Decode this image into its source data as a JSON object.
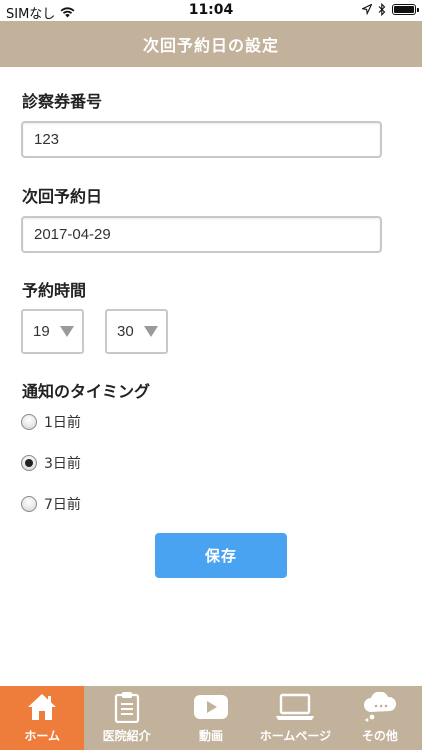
{
  "status_bar": {
    "carrier": "SIMなし",
    "time": "11:04"
  },
  "header": {
    "title": "次回予約日の設定"
  },
  "form": {
    "card_number": {
      "label": "診察券番号",
      "value": "123"
    },
    "next_date": {
      "label": "次回予約日",
      "value": "2017-04-29"
    },
    "time": {
      "label": "予約時間",
      "hour": "19",
      "minute": "30"
    },
    "timing": {
      "label": "通知のタイミング",
      "options": [
        {
          "label": "1日前",
          "checked": false
        },
        {
          "label": "3日前",
          "checked": true
        },
        {
          "label": "7日前",
          "checked": false
        }
      ]
    },
    "save_label": "保存"
  },
  "tabs": [
    {
      "label": "ホーム",
      "icon": "home-icon",
      "active": true
    },
    {
      "label": "医院紹介",
      "icon": "clipboard-icon",
      "active": false
    },
    {
      "label": "動画",
      "icon": "play-icon",
      "active": false
    },
    {
      "label": "ホームページ",
      "icon": "laptop-icon",
      "active": false
    },
    {
      "label": "その他",
      "icon": "cloud-icon",
      "active": false
    }
  ],
  "colors": {
    "header": "#c2b29b",
    "tab_active": "#ee7d3c",
    "save_button": "#4aa3f0"
  }
}
